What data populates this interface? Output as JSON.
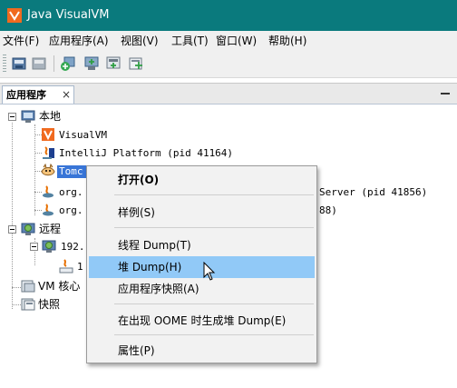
{
  "window": {
    "title": "Java VisualVM"
  },
  "menubar": {
    "items": [
      "文件(F)",
      "应用程序(A)",
      "视图(V)",
      "工具(T)",
      "窗口(W)",
      "帮助(H)"
    ]
  },
  "panel": {
    "tab_label": "应用程序",
    "tab_close": "×"
  },
  "tree": {
    "local": {
      "label": "本地"
    },
    "apps": [
      {
        "label": "VisualVM"
      },
      {
        "label": "IntelliJ Platform (pid 41164)"
      },
      {
        "label": "Tomc"
      },
      {
        "label": "org."
      },
      {
        "label": "org."
      }
    ],
    "app4_trail": "Server (pid 41856)",
    "app5_trail": "88)",
    "remote": {
      "label": "远程"
    },
    "remote_host": {
      "label": "192."
    },
    "remote_child": {
      "label": "1"
    },
    "vm_core": {
      "label": "VM 核心"
    },
    "snapshots": {
      "label": "快照"
    }
  },
  "context_menu": {
    "items": [
      {
        "label": "打开(O)"
      },
      {
        "label": "样例(S)"
      },
      {
        "label": "线程 Dump(T)"
      },
      {
        "label": "堆 Dump(H)"
      },
      {
        "label": "应用程序快照(A)"
      },
      {
        "label": "在出现 OOME 时生成堆 Dump(E)"
      },
      {
        "label": "属性(P)"
      }
    ],
    "hovered_index": 3
  },
  "colors": {
    "titlebar": "#0a7a7d",
    "selection": "#3875d7",
    "menu_hover": "#91c9f7"
  }
}
